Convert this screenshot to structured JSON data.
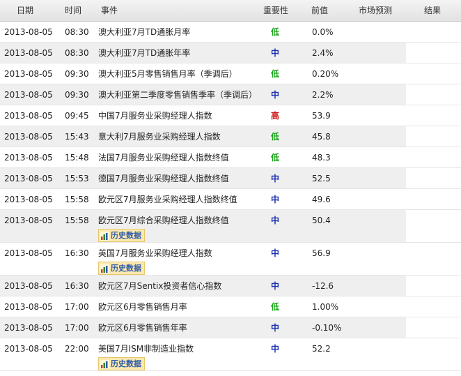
{
  "header": {
    "date": "日期",
    "time": "时间",
    "event": "事件",
    "importance": "重要性",
    "previous": "前值",
    "forecast": "市场预测",
    "result": "结果"
  },
  "history_label": "历史数据",
  "rows": [
    {
      "date": "2013-08-05",
      "time": "08:30",
      "event": "澳大利亚7月TD通胀月率",
      "importance": "低",
      "previous": "0.0%"
    },
    {
      "date": "2013-08-05",
      "time": "08:30",
      "event": "澳大利亚7月TD通胀年率",
      "importance": "中",
      "previous": "2.4%"
    },
    {
      "date": "2013-08-05",
      "time": "09:30",
      "event": "澳大利亚5月零售销售月率（季调后）",
      "importance": "低",
      "previous": "0.20%"
    },
    {
      "date": "2013-08-05",
      "time": "09:30",
      "event": "澳大利亚第二季度零售销售季率（季调后）",
      "importance": "中",
      "previous": "2.2%"
    },
    {
      "date": "2013-08-05",
      "time": "09:45",
      "event": "中国7月服务业采购经理人指数",
      "importance": "高",
      "previous": "53.9"
    },
    {
      "date": "2013-08-05",
      "time": "15:43",
      "event": "意大利7月服务业采购经理人指数",
      "importance": "低",
      "previous": "45.8"
    },
    {
      "date": "2013-08-05",
      "time": "15:48",
      "event": "法国7月服务业采购经理人指数终值",
      "importance": "低",
      "previous": "48.3"
    },
    {
      "date": "2013-08-05",
      "time": "15:53",
      "event": "德国7月服务业采购经理人指数终值",
      "importance": "中",
      "previous": "52.5"
    },
    {
      "date": "2013-08-05",
      "time": "15:58",
      "event": "欧元区7月服务业采购经理人指数终值",
      "importance": "中",
      "previous": "49.6"
    },
    {
      "date": "2013-08-05",
      "time": "15:58",
      "event": "欧元区7月综合采购经理人指数终值",
      "importance": "中",
      "previous": "50.4",
      "history": true
    },
    {
      "date": "2013-08-05",
      "time": "16:30",
      "event": "英国7月服务业采购经理人指数",
      "importance": "中",
      "previous": "56.9",
      "history": true
    },
    {
      "date": "2013-08-05",
      "time": "16:30",
      "event": "欧元区7月Sentix投资者信心指数",
      "importance": "中",
      "previous": "-12.6"
    },
    {
      "date": "2013-08-05",
      "time": "17:00",
      "event": "欧元区6月零售销售月率",
      "importance": "低",
      "previous": "1.00%"
    },
    {
      "date": "2013-08-05",
      "time": "17:00",
      "event": "欧元区6月零售销售年率",
      "importance": "中",
      "previous": "-0.10%"
    },
    {
      "date": "2013-08-05",
      "time": "22:00",
      "event": "美国7月ISM非制造业指数",
      "importance": "中",
      "previous": "52.2",
      "history": true
    }
  ]
}
